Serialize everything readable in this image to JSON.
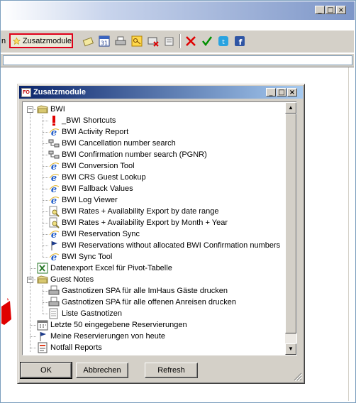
{
  "outer_window": {
    "controls": {
      "minimize": "_",
      "maximize": "□",
      "close": "×"
    }
  },
  "toolbar": {
    "zusatzmodule_label": "Zusatzmodule",
    "left_fragment": "n",
    "icons": [
      "star-icon",
      "note-icon",
      "calendar-icon",
      "printer-icon",
      "key-icon",
      "card-x-icon",
      "document-icon",
      "red-x-icon",
      "green-check-icon",
      "twitter-icon",
      "facebook-icon"
    ],
    "calendar_label": "31"
  },
  "dialog": {
    "title": "Zusatzmodule",
    "app_badge": "FO",
    "controls": {
      "minimize": "_",
      "maximize": "□",
      "close": "×"
    },
    "tree": [
      {
        "label": "BWI",
        "level": 0,
        "icon": "folder-icon",
        "expander": "−"
      },
      {
        "label": "_BWI Shortcuts",
        "level": 1,
        "icon": "exclamation-icon"
      },
      {
        "label": "BWI Activity Report",
        "level": 1,
        "icon": "ie-icon"
      },
      {
        "label": "BWI Cancellation number search",
        "level": 1,
        "icon": "network-icon"
      },
      {
        "label": "BWI Confirmation number search (PGNR)",
        "level": 1,
        "icon": "network-icon"
      },
      {
        "label": "BWI Conversion Tool",
        "level": 1,
        "icon": "ie-icon"
      },
      {
        "label": "BWI CRS Guest Lookup",
        "level": 1,
        "icon": "ie-icon"
      },
      {
        "label": "BWI Fallback Values",
        "level": 1,
        "icon": "ie-icon"
      },
      {
        "label": "BWI Log Viewer",
        "level": 1,
        "icon": "ie-icon"
      },
      {
        "label": "BWI Rates + Availability Export by date range",
        "level": 1,
        "icon": "search-doc-icon"
      },
      {
        "label": "BWI Rates + Availability Export by Month + Year",
        "level": 1,
        "icon": "search-doc-icon"
      },
      {
        "label": "BWI Reservation Sync",
        "level": 1,
        "icon": "ie-icon"
      },
      {
        "label": "BWI Reservations without allocated BWI Confirmation numbers",
        "level": 1,
        "icon": "flag-icon"
      },
      {
        "label": "BWI Sync Tool",
        "level": 1,
        "icon": "ie-icon"
      },
      {
        "label": "Datenexport Excel für Pivot-Tabelle",
        "level": 0,
        "icon": "excel-icon"
      },
      {
        "label": "Guest Notes",
        "level": 0,
        "icon": "folder-icon",
        "expander": "−"
      },
      {
        "label": "Gastnotizen SPA für alle ImHaus Gäste drucken",
        "level": 1,
        "icon": "printer-icon"
      },
      {
        "label": "Gastnotizen SPA für alle offenen Anreisen drucken",
        "level": 1,
        "icon": "printer-icon"
      },
      {
        "label": "Liste Gastnotizen",
        "level": 1,
        "icon": "list-icon"
      },
      {
        "label": "Letzte 50 eingegebene Reservierungen",
        "level": 0,
        "icon": "calendar-icon"
      },
      {
        "label": "Meine Reservierungen von heute",
        "level": 0,
        "icon": "flag-icon"
      },
      {
        "label": "Notfall Reports",
        "level": 0,
        "icon": "report-icon"
      }
    ],
    "buttons": {
      "ok": "OK",
      "cancel": "Abbrechen",
      "refresh": "Refresh"
    },
    "scroll": {
      "up": "▲",
      "down": "▼"
    }
  }
}
